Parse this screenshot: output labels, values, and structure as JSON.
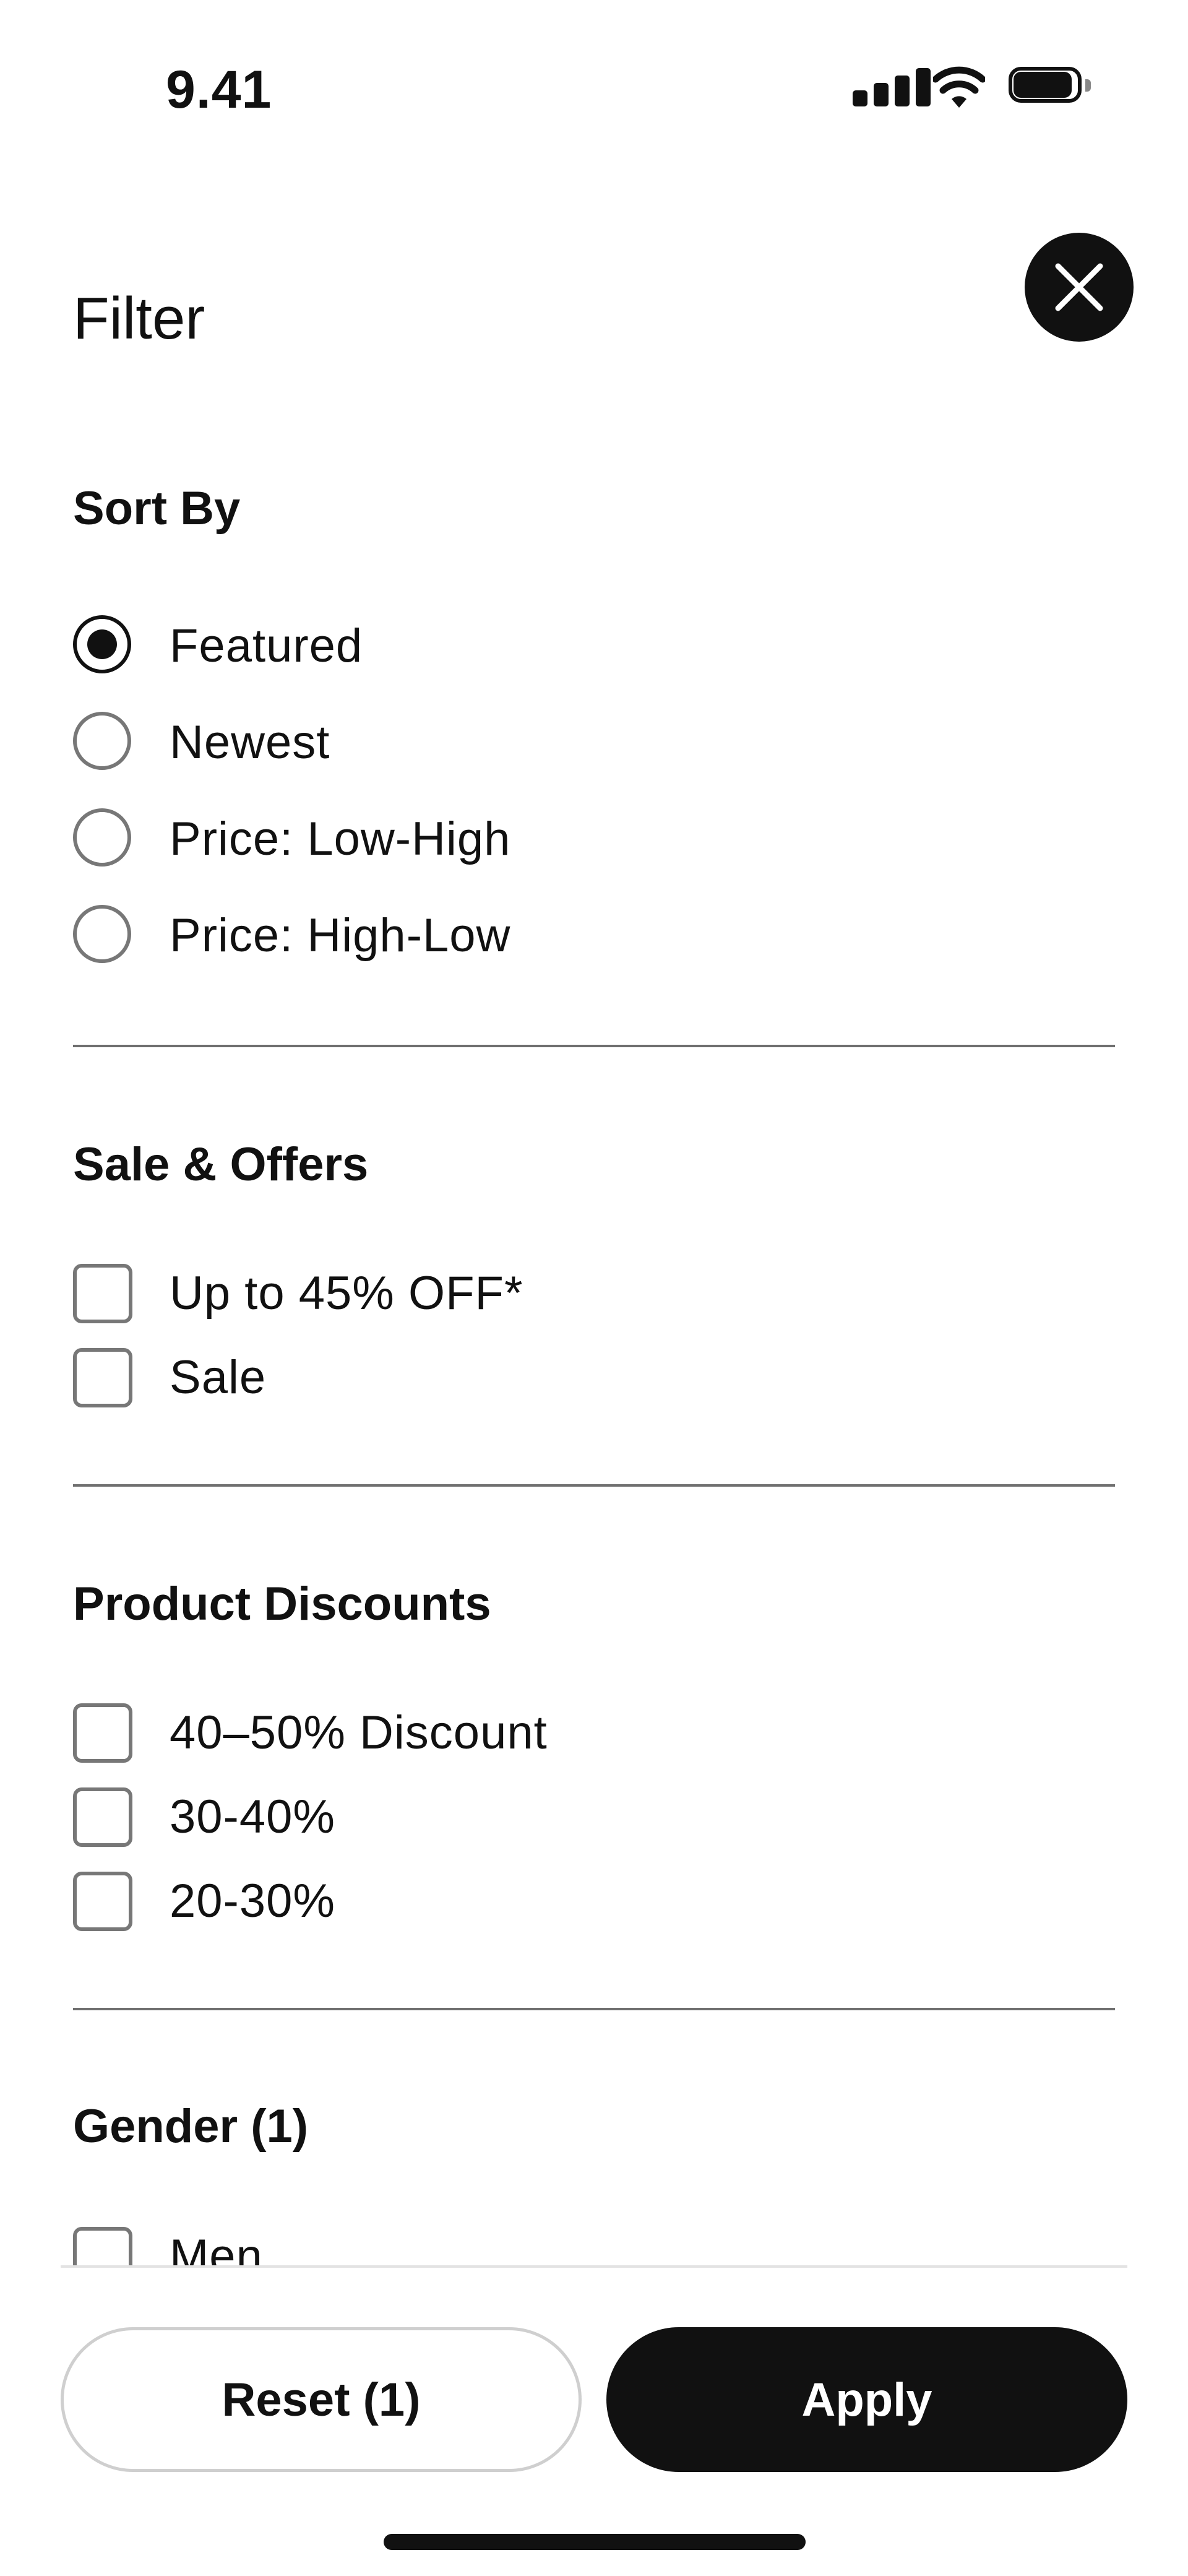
{
  "status_bar": {
    "time": "9.41"
  },
  "header": {
    "title": "Filter",
    "close_icon": "close-icon"
  },
  "sort_by": {
    "title": "Sort By",
    "options": [
      {
        "label": "Featured",
        "selected": true
      },
      {
        "label": "Newest",
        "selected": false
      },
      {
        "label": "Price: Low-High",
        "selected": false
      },
      {
        "label": "Price: High-Low",
        "selected": false
      }
    ]
  },
  "sale_offers": {
    "title": "Sale & Offers",
    "options": [
      {
        "label": "Up to 45% OFF*",
        "checked": false
      },
      {
        "label": "Sale",
        "checked": false
      }
    ]
  },
  "product_discounts": {
    "title": "Product Discounts",
    "options": [
      {
        "label": "40–50% Discount",
        "checked": false
      },
      {
        "label": "30-40%",
        "checked": false
      },
      {
        "label": "20-30%",
        "checked": false
      }
    ]
  },
  "gender": {
    "title": "Gender (1)",
    "options": [
      {
        "label": "Men",
        "checked": false
      }
    ]
  },
  "footer": {
    "reset_label": "Reset (1)",
    "apply_label": "Apply"
  },
  "colors": {
    "primary": "#111111",
    "border": "#777777",
    "divider": "#6f6f6f"
  }
}
